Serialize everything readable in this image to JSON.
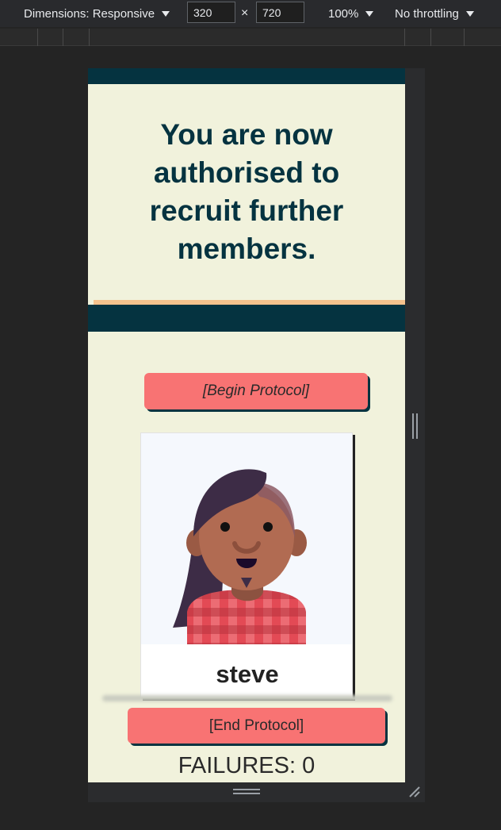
{
  "devtools": {
    "dimensions_label": "Dimensions: Responsive",
    "width_value": "320",
    "times_symbol": "×",
    "height_value": "720",
    "zoom_label": "100%",
    "throttle_label": "No throttling"
  },
  "page": {
    "headline": "You are now authorised to recruit further members.",
    "begin_button": "[Begin Protocol]",
    "member_name": "steve",
    "end_button": "[End Protocol]",
    "failures_text": "FAILURES: 0"
  },
  "colors": {
    "dark_teal": "#053340",
    "cream": "#f1f2dc",
    "button_red": "#f87373",
    "accent_peach": "#f5c28d"
  },
  "icons": {
    "dropdown": "chevron-down-icon",
    "avatar": "avatar-illustration"
  }
}
